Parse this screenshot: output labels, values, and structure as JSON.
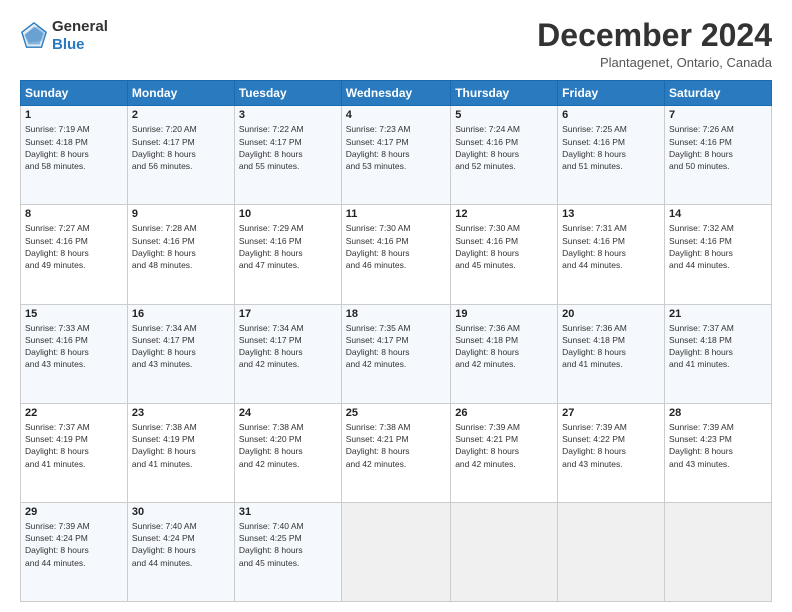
{
  "header": {
    "logo_line1": "General",
    "logo_line2": "Blue",
    "month_title": "December 2024",
    "location": "Plantagenet, Ontario, Canada"
  },
  "days_of_week": [
    "Sunday",
    "Monday",
    "Tuesday",
    "Wednesday",
    "Thursday",
    "Friday",
    "Saturday"
  ],
  "weeks": [
    [
      {
        "day": "1",
        "sunrise": "7:19 AM",
        "sunset": "4:18 PM",
        "daylight": "8 hours and 58 minutes."
      },
      {
        "day": "2",
        "sunrise": "7:20 AM",
        "sunset": "4:17 PM",
        "daylight": "8 hours and 56 minutes."
      },
      {
        "day": "3",
        "sunrise": "7:22 AM",
        "sunset": "4:17 PM",
        "daylight": "8 hours and 55 minutes."
      },
      {
        "day": "4",
        "sunrise": "7:23 AM",
        "sunset": "4:17 PM",
        "daylight": "8 hours and 53 minutes."
      },
      {
        "day": "5",
        "sunrise": "7:24 AM",
        "sunset": "4:16 PM",
        "daylight": "8 hours and 52 minutes."
      },
      {
        "day": "6",
        "sunrise": "7:25 AM",
        "sunset": "4:16 PM",
        "daylight": "8 hours and 51 minutes."
      },
      {
        "day": "7",
        "sunrise": "7:26 AM",
        "sunset": "4:16 PM",
        "daylight": "8 hours and 50 minutes."
      }
    ],
    [
      {
        "day": "8",
        "sunrise": "7:27 AM",
        "sunset": "4:16 PM",
        "daylight": "8 hours and 49 minutes."
      },
      {
        "day": "9",
        "sunrise": "7:28 AM",
        "sunset": "4:16 PM",
        "daylight": "8 hours and 48 minutes."
      },
      {
        "day": "10",
        "sunrise": "7:29 AM",
        "sunset": "4:16 PM",
        "daylight": "8 hours and 47 minutes."
      },
      {
        "day": "11",
        "sunrise": "7:30 AM",
        "sunset": "4:16 PM",
        "daylight": "8 hours and 46 minutes."
      },
      {
        "day": "12",
        "sunrise": "7:30 AM",
        "sunset": "4:16 PM",
        "daylight": "8 hours and 45 minutes."
      },
      {
        "day": "13",
        "sunrise": "7:31 AM",
        "sunset": "4:16 PM",
        "daylight": "8 hours and 44 minutes."
      },
      {
        "day": "14",
        "sunrise": "7:32 AM",
        "sunset": "4:16 PM",
        "daylight": "8 hours and 44 minutes."
      }
    ],
    [
      {
        "day": "15",
        "sunrise": "7:33 AM",
        "sunset": "4:16 PM",
        "daylight": "8 hours and 43 minutes."
      },
      {
        "day": "16",
        "sunrise": "7:34 AM",
        "sunset": "4:17 PM",
        "daylight": "8 hours and 43 minutes."
      },
      {
        "day": "17",
        "sunrise": "7:34 AM",
        "sunset": "4:17 PM",
        "daylight": "8 hours and 42 minutes."
      },
      {
        "day": "18",
        "sunrise": "7:35 AM",
        "sunset": "4:17 PM",
        "daylight": "8 hours and 42 minutes."
      },
      {
        "day": "19",
        "sunrise": "7:36 AM",
        "sunset": "4:18 PM",
        "daylight": "8 hours and 42 minutes."
      },
      {
        "day": "20",
        "sunrise": "7:36 AM",
        "sunset": "4:18 PM",
        "daylight": "8 hours and 41 minutes."
      },
      {
        "day": "21",
        "sunrise": "7:37 AM",
        "sunset": "4:18 PM",
        "daylight": "8 hours and 41 minutes."
      }
    ],
    [
      {
        "day": "22",
        "sunrise": "7:37 AM",
        "sunset": "4:19 PM",
        "daylight": "8 hours and 41 minutes."
      },
      {
        "day": "23",
        "sunrise": "7:38 AM",
        "sunset": "4:19 PM",
        "daylight": "8 hours and 41 minutes."
      },
      {
        "day": "24",
        "sunrise": "7:38 AM",
        "sunset": "4:20 PM",
        "daylight": "8 hours and 42 minutes."
      },
      {
        "day": "25",
        "sunrise": "7:38 AM",
        "sunset": "4:21 PM",
        "daylight": "8 hours and 42 minutes."
      },
      {
        "day": "26",
        "sunrise": "7:39 AM",
        "sunset": "4:21 PM",
        "daylight": "8 hours and 42 minutes."
      },
      {
        "day": "27",
        "sunrise": "7:39 AM",
        "sunset": "4:22 PM",
        "daylight": "8 hours and 43 minutes."
      },
      {
        "day": "28",
        "sunrise": "7:39 AM",
        "sunset": "4:23 PM",
        "daylight": "8 hours and 43 minutes."
      }
    ],
    [
      {
        "day": "29",
        "sunrise": "7:39 AM",
        "sunset": "4:24 PM",
        "daylight": "8 hours and 44 minutes."
      },
      {
        "day": "30",
        "sunrise": "7:40 AM",
        "sunset": "4:24 PM",
        "daylight": "8 hours and 44 minutes."
      },
      {
        "day": "31",
        "sunrise": "7:40 AM",
        "sunset": "4:25 PM",
        "daylight": "8 hours and 45 minutes."
      },
      null,
      null,
      null,
      null
    ]
  ]
}
